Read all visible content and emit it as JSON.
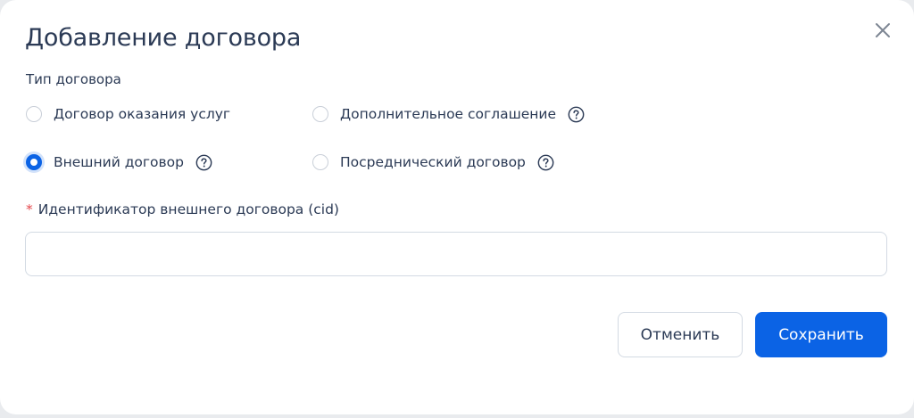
{
  "dialog": {
    "title": "Добавление договора",
    "close_icon": "close-icon"
  },
  "contract_type": {
    "label": "Тип договора",
    "options": [
      {
        "label": "Договор оказания услуг",
        "checked": false,
        "has_help": false
      },
      {
        "label": "Дополнительное соглашение",
        "checked": false,
        "has_help": true
      },
      {
        "label": "Внешний договор",
        "checked": true,
        "has_help": true
      },
      {
        "label": "Посреднический договор",
        "checked": false,
        "has_help": true
      }
    ],
    "help_icon": "question-circle-icon"
  },
  "cid_field": {
    "required_mark": "*",
    "label": "Идентификатор внешнего договора (cid)",
    "value": "",
    "placeholder": ""
  },
  "actions": {
    "cancel_label": "Отменить",
    "save_label": "Сохранить"
  },
  "colors": {
    "primary": "#0b63e5",
    "text": "#2b3a55",
    "required": "#e5484d",
    "border": "#d3dae3"
  }
}
